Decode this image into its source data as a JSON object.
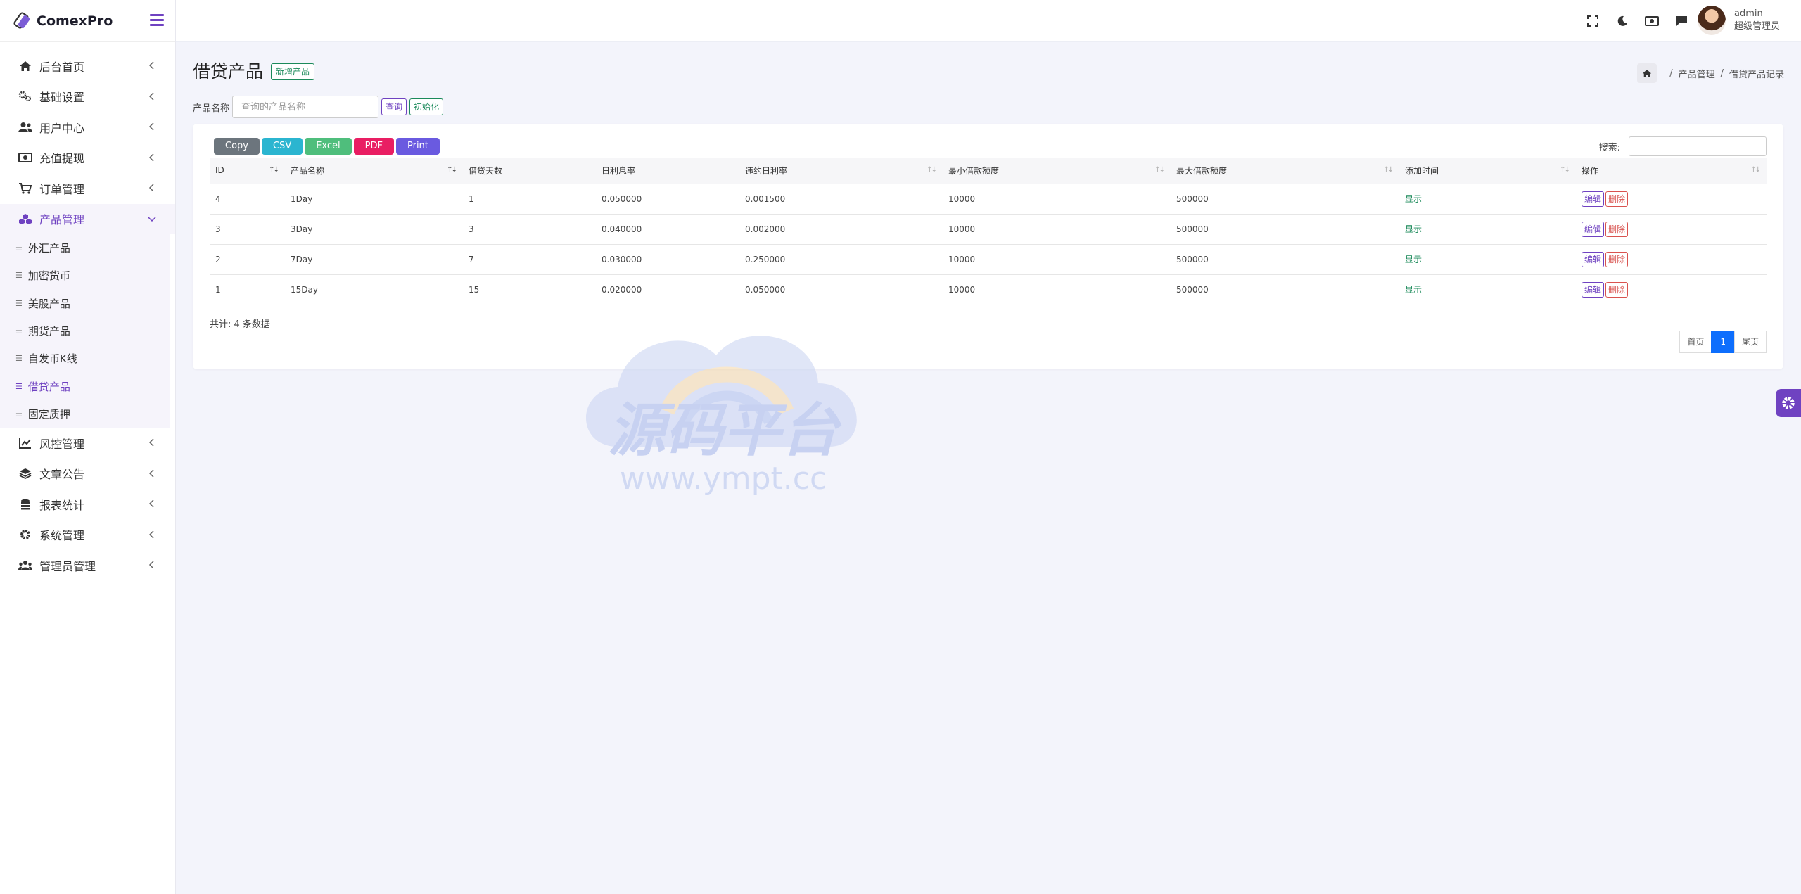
{
  "brand": {
    "name": "ComexPro"
  },
  "sidebar": {
    "items": [
      {
        "label": "后台首页",
        "icon": "home-icon"
      },
      {
        "label": "基础设置",
        "icon": "gears-icon"
      },
      {
        "label": "用户中心",
        "icon": "users-icon"
      },
      {
        "label": "充值提现",
        "icon": "money-icon"
      },
      {
        "label": "订单管理",
        "icon": "cart-icon"
      },
      {
        "label": "产品管理",
        "icon": "cubes-icon"
      },
      {
        "label": "风控管理",
        "icon": "chart-line-icon"
      },
      {
        "label": "文章公告",
        "icon": "layers-icon"
      },
      {
        "label": "报表统计",
        "icon": "database-icon"
      },
      {
        "label": "系统管理",
        "icon": "gear-icon"
      },
      {
        "label": "管理员管理",
        "icon": "user-group-icon"
      }
    ],
    "product_sub": [
      "外汇产品",
      "加密货币",
      "美股产品",
      "期货产品",
      "自发币K线",
      "借贷产品",
      "固定质押"
    ]
  },
  "header": {
    "user_name": "admin",
    "user_role": "超级管理员"
  },
  "page": {
    "title": "借贷产品",
    "new_button": "新增产品",
    "breadcrumb": [
      "产品管理",
      "借贷产品记录"
    ]
  },
  "filter": {
    "label": "产品名称",
    "placeholder": "查询的产品名称",
    "query_button": "查询",
    "reset_button": "初始化"
  },
  "toolbar": {
    "buttons": [
      {
        "label": "Copy",
        "color": "#6c757d"
      },
      {
        "label": "CSV",
        "color": "#2bb5d0"
      },
      {
        "label": "Excel",
        "color": "#4fbe7c"
      },
      {
        "label": "PDF",
        "color": "#e91e63"
      },
      {
        "label": "Print",
        "color": "#6a5ae0"
      }
    ],
    "search_label": "搜索:"
  },
  "table": {
    "columns": [
      "ID",
      "产品名称",
      "借贷天数",
      "日利息率",
      "违约日利率",
      "最小借款额度",
      "最大借款额度",
      "添加时间",
      "操作"
    ],
    "rows": [
      {
        "id": "4",
        "name": "1Day",
        "days": "1",
        "daily_rate": "0.050000",
        "penalty_rate": "0.001500",
        "min": "10000",
        "max": "500000",
        "time": "显示"
      },
      {
        "id": "3",
        "name": "3Day",
        "days": "3",
        "daily_rate": "0.040000",
        "penalty_rate": "0.002000",
        "min": "10000",
        "max": "500000",
        "time": "显示"
      },
      {
        "id": "2",
        "name": "7Day",
        "days": "7",
        "daily_rate": "0.030000",
        "penalty_rate": "0.250000",
        "min": "10000",
        "max": "500000",
        "time": "显示"
      },
      {
        "id": "1",
        "name": "15Day",
        "days": "15",
        "daily_rate": "0.020000",
        "penalty_rate": "0.050000",
        "min": "10000",
        "max": "500000",
        "time": "显示"
      }
    ],
    "edit_label": "编辑",
    "delete_label": "删除"
  },
  "footer": {
    "total": "共计: 4 条数据",
    "pager": {
      "first": "首页",
      "current": "1",
      "last": "尾页"
    }
  },
  "watermark": {
    "title": "源码平台",
    "url": "www.ympt.cc"
  },
  "colors": {
    "accent": "#6f42c1",
    "success": "#1b8a5a",
    "danger": "#d9534f",
    "primary": "#0d6efd"
  }
}
